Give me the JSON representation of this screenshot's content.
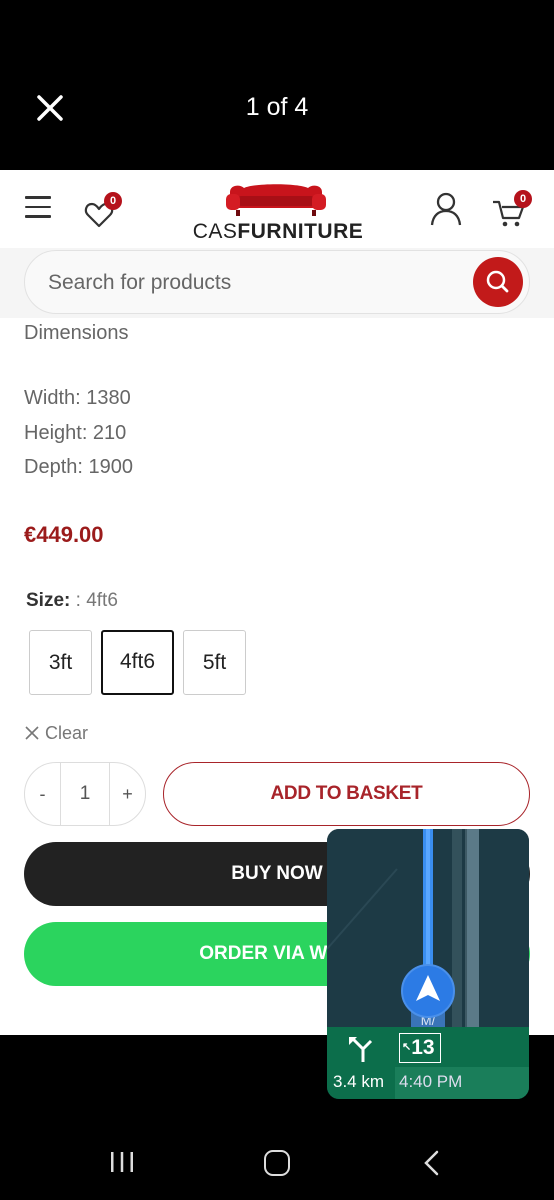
{
  "viewer": {
    "title": "1 of 4",
    "close_icon": "close-icon"
  },
  "header": {
    "wishlist_count": "0",
    "cart_count": "0",
    "logo_thin": "CAS",
    "logo_bold": "FURNITURE"
  },
  "search": {
    "placeholder": "Search for products"
  },
  "product": {
    "dimensions_title": "Dimensions",
    "width": "Width: 1380",
    "height": "Height: 210",
    "depth": "Depth: 1900",
    "price": "€449.00",
    "size_label": "Size:",
    "size_value": ": 4ft6",
    "sizes": [
      "3ft",
      "4ft6",
      "5ft"
    ],
    "selected_size": "4ft6",
    "clear": "Clear",
    "quantity": "1",
    "qty_minus": "-",
    "qty_plus": "+",
    "add_to_basket": "ADD TO BASKET",
    "buy_now": "BUY NOW",
    "order_whatsapp": "ORDER VIA WHA"
  },
  "navigation": {
    "road_label": "M/",
    "exit": "13",
    "distance": "3.4 km",
    "arrival": "4:40 PM"
  },
  "colors": {
    "brand_red": "#b5121b",
    "price": "#9b1b1b",
    "whatsapp_green": "#2bd45e",
    "nav_green": "#0c6e4b"
  }
}
